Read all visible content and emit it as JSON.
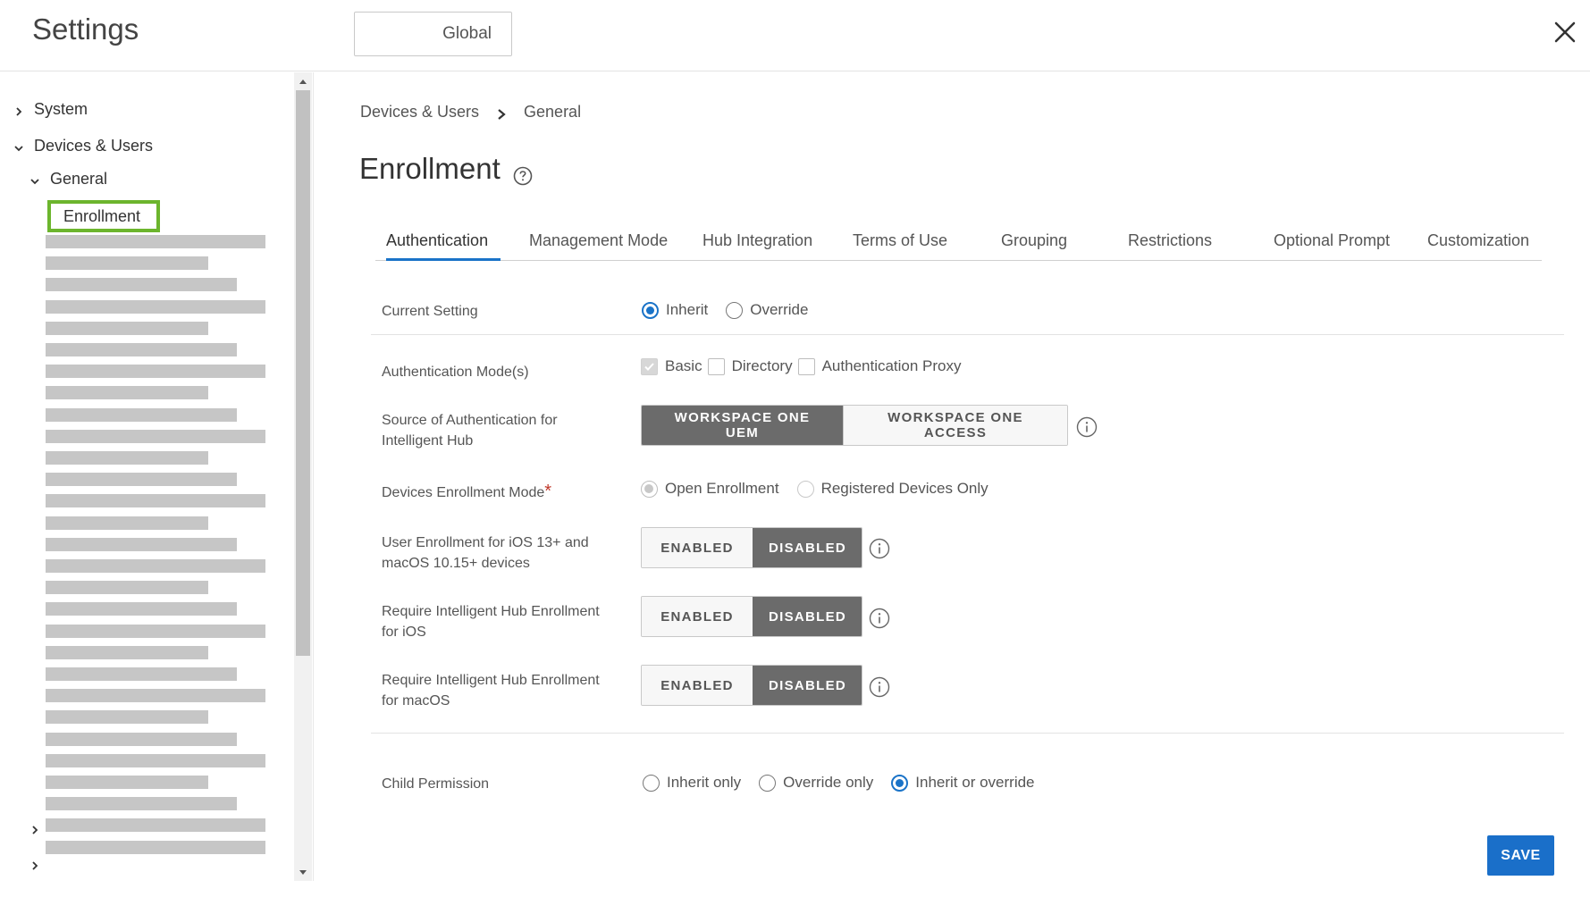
{
  "header": {
    "title": "Settings",
    "scope_button": "Global",
    "close_icon": "close-icon"
  },
  "sidebar": {
    "items": [
      {
        "label": "System",
        "state": "collapsed"
      },
      {
        "label": "Devices & Users",
        "state": "expanded"
      },
      {
        "label": "General",
        "state": "expanded"
      },
      {
        "label": "Enrollment",
        "state": "selected"
      }
    ],
    "highlight_color": "#6cb52d"
  },
  "breadcrumb": {
    "parent": "Devices & Users",
    "current": "General"
  },
  "page": {
    "title": "Enrollment",
    "help_icon": "help-icon"
  },
  "tabs": [
    {
      "label": "Authentication",
      "active": true
    },
    {
      "label": "Management Mode"
    },
    {
      "label": "Hub Integration"
    },
    {
      "label": "Terms of Use"
    },
    {
      "label": "Grouping"
    },
    {
      "label": "Restrictions"
    },
    {
      "label": "Optional Prompt"
    },
    {
      "label": "Customization"
    }
  ],
  "form": {
    "current_setting": {
      "label": "Current Setting",
      "options": [
        "Inherit",
        "Override"
      ],
      "selected": "Inherit"
    },
    "auth_modes": {
      "label": "Authentication Mode(s)",
      "options": [
        "Basic",
        "Directory",
        "Authentication Proxy"
      ],
      "checked": [
        "Basic"
      ]
    },
    "auth_source": {
      "label_line1": "Source of Authentication for",
      "label_line2": "Intelligent Hub",
      "options": [
        "WORKSPACE ONE UEM",
        "WORKSPACE ONE ACCESS"
      ],
      "selected": "WORKSPACE ONE UEM"
    },
    "enrollment_mode": {
      "label": "Devices Enrollment Mode",
      "required_mark": "*",
      "options": [
        "Open Enrollment",
        "Registered Devices Only"
      ],
      "selected": "Open Enrollment"
    },
    "user_enrollment": {
      "label_line1": "User Enrollment for iOS 13+ and",
      "label_line2": "macOS 10.15+ devices",
      "options": [
        "ENABLED",
        "DISABLED"
      ],
      "selected": "DISABLED"
    },
    "hub_ios": {
      "label_line1": "Require Intelligent Hub Enrollment",
      "label_line2": "for iOS",
      "options": [
        "ENABLED",
        "DISABLED"
      ],
      "selected": "DISABLED"
    },
    "hub_macos": {
      "label_line1": "Require Intelligent Hub Enrollment",
      "label_line2": "for macOS",
      "options": [
        "ENABLED",
        "DISABLED"
      ],
      "selected": "DISABLED"
    },
    "child_permission": {
      "label": "Child Permission",
      "options": [
        "Inherit only",
        "Override only",
        "Inherit or override"
      ],
      "selected": "Inherit or override"
    }
  },
  "actions": {
    "save": "SAVE"
  },
  "colors": {
    "accent": "#1a73c8",
    "segment_active": "#6b6b6b",
    "save_button": "#1a6fc9"
  }
}
